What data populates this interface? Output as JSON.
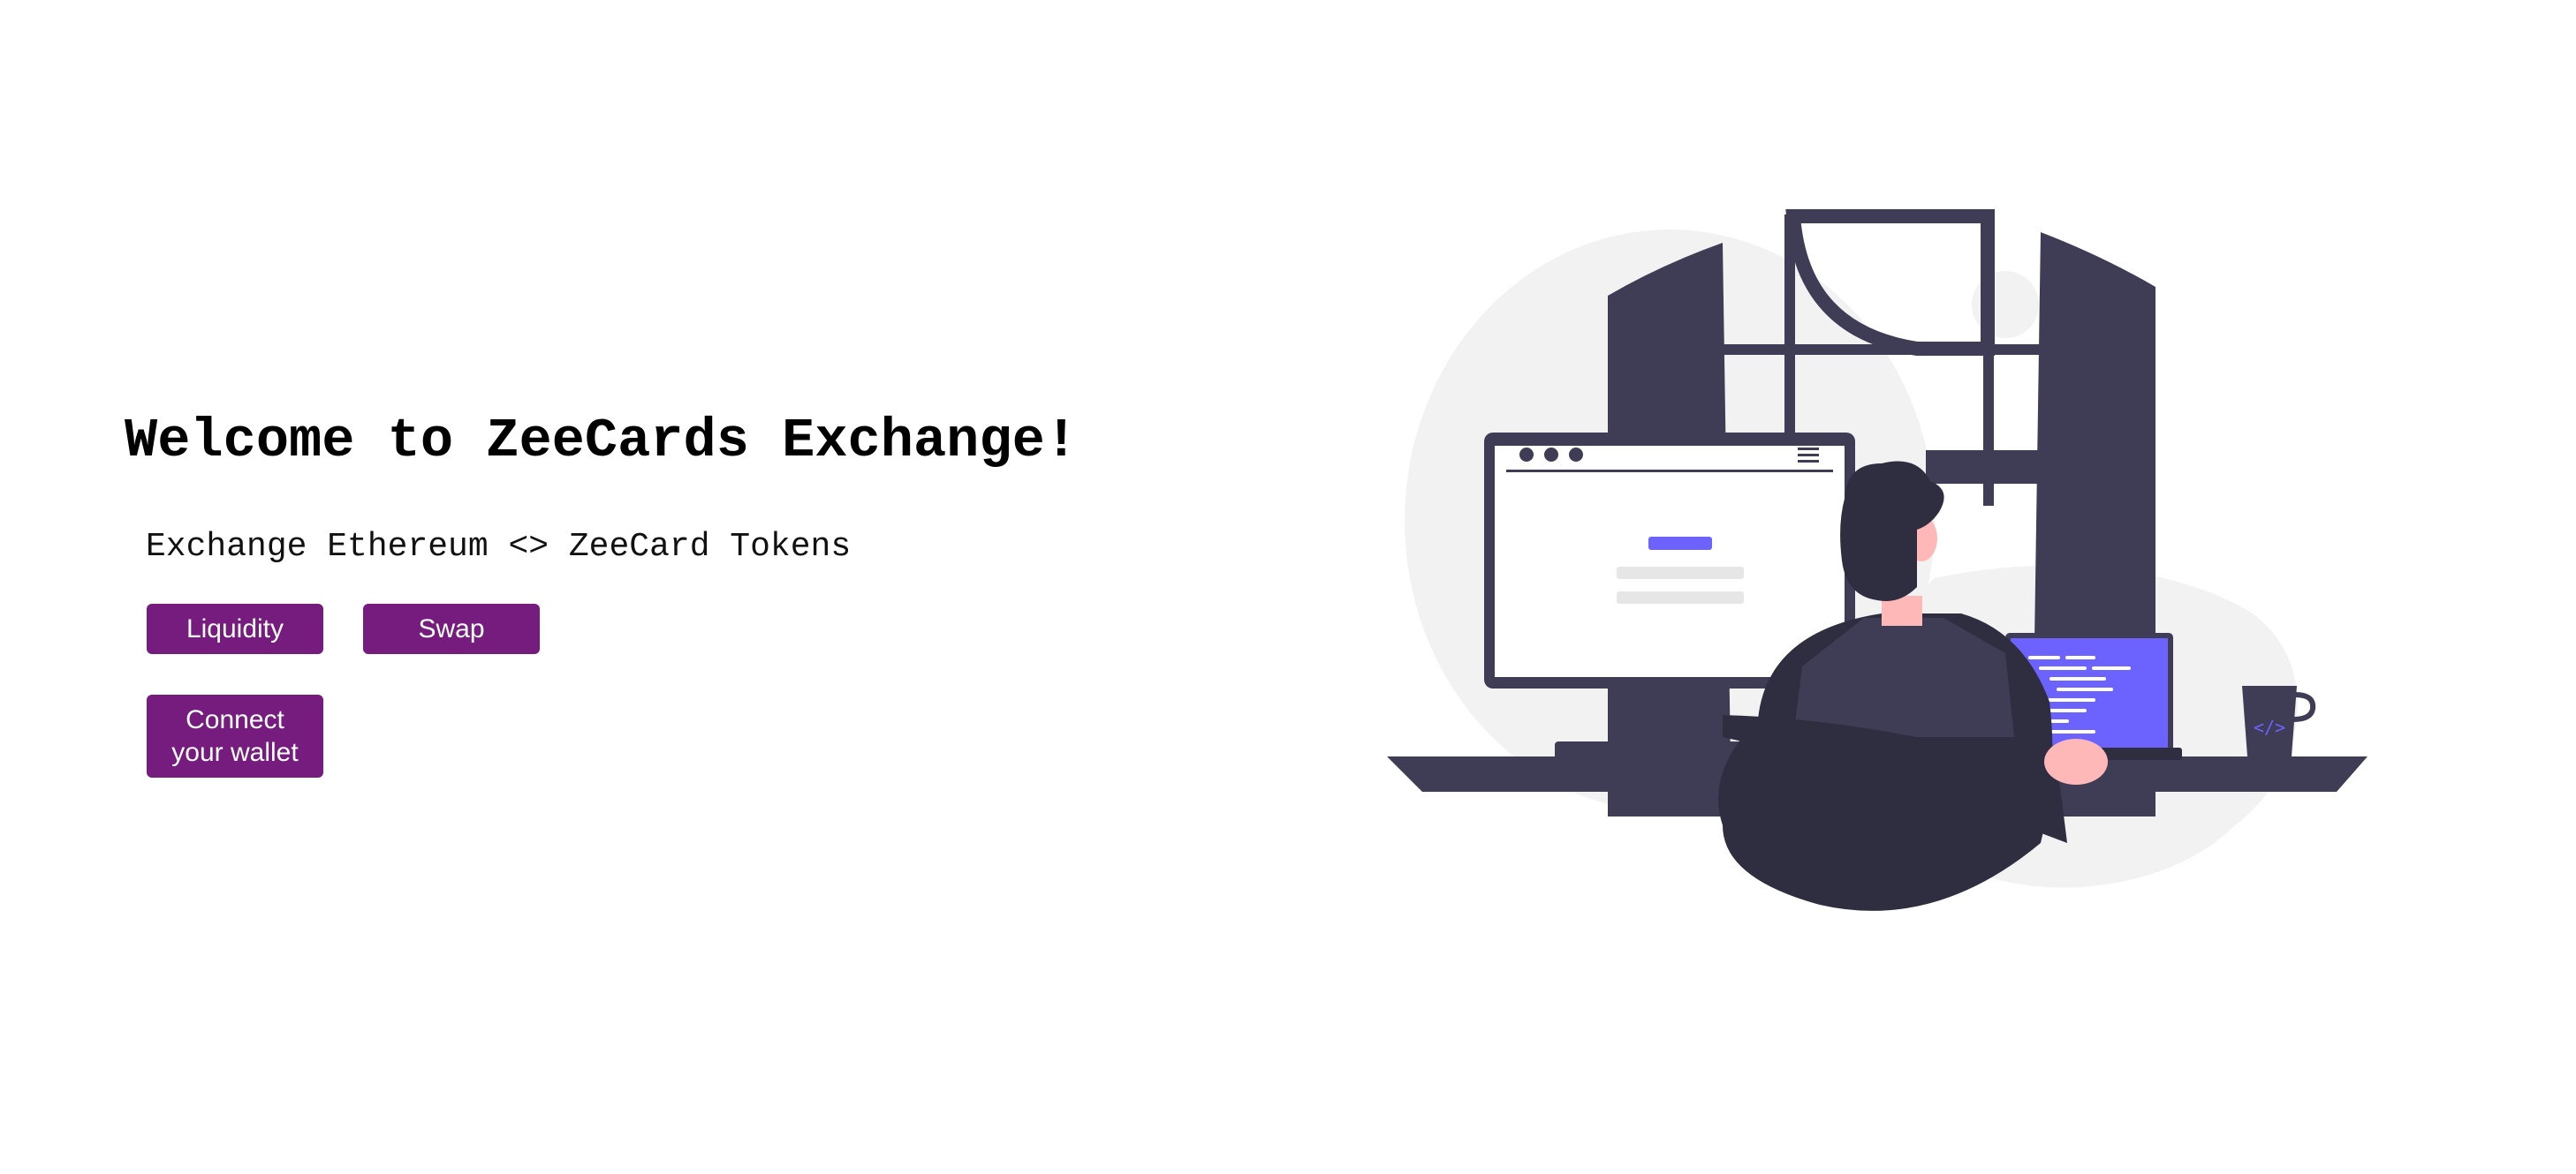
{
  "hero": {
    "title": "Welcome to ZeeCards Exchange!",
    "subtitle": "Exchange Ethereum <> ZeeCard Tokens"
  },
  "actions": {
    "liquidity_label": "Liquidity",
    "swap_label": "Swap",
    "connect_label": "Connect\nyour wallet"
  },
  "illustration": {
    "monitor_code_icon": "code-brackets-icon"
  },
  "colors": {
    "button": "#771c7f",
    "accent": "#6c63ff",
    "dark": "#3f3d56",
    "background_blob": "#f2f2f2"
  }
}
